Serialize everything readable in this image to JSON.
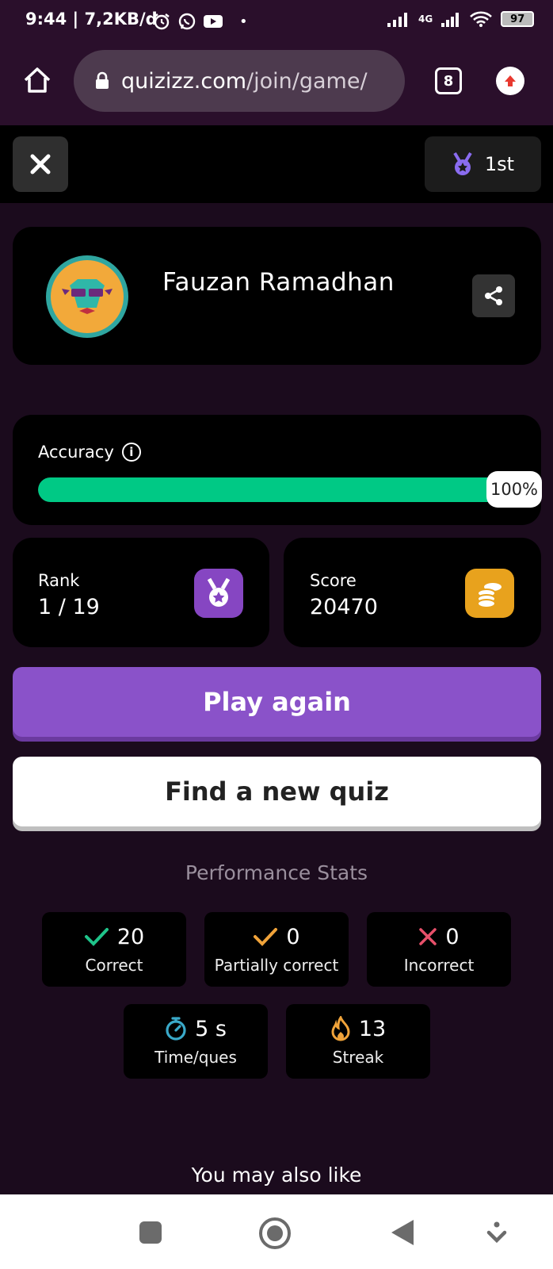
{
  "status_bar": {
    "time_speed": "9:44 | 7,2KB/d",
    "network": "4G",
    "battery": "97"
  },
  "browser": {
    "url_domain": "quizizz.com",
    "url_path": "/join/game/",
    "tab_count": "8"
  },
  "header": {
    "rank_badge": "1st"
  },
  "profile": {
    "name": "Fauzan Ramadhan"
  },
  "accuracy": {
    "label": "Accuracy",
    "value": 100,
    "value_label": "100%",
    "bar_color": "#00c985"
  },
  "rank": {
    "label": "Rank",
    "value": "1 / 19"
  },
  "score": {
    "label": "Score",
    "value": "20470"
  },
  "buttons": {
    "play_again": "Play again",
    "find_quiz": "Find a new quiz"
  },
  "performance": {
    "title": "Performance Stats",
    "correct": {
      "value": "20",
      "label": "Correct"
    },
    "partial": {
      "value": "0",
      "label": "Partially correct"
    },
    "incorrect": {
      "value": "0",
      "label": "Incorrect"
    },
    "time": {
      "value": "5 s",
      "label": "Time/ques"
    },
    "streak": {
      "value": "13",
      "label": "Streak"
    }
  },
  "footer": {
    "you_may_also_like": "You may also like"
  },
  "colors": {
    "accent_purple": "#8a52c9",
    "correct_green": "#1fc48a",
    "partial_orange": "#f0a33a",
    "incorrect_red": "#e8506a",
    "time_teal": "#3aa9c9"
  }
}
